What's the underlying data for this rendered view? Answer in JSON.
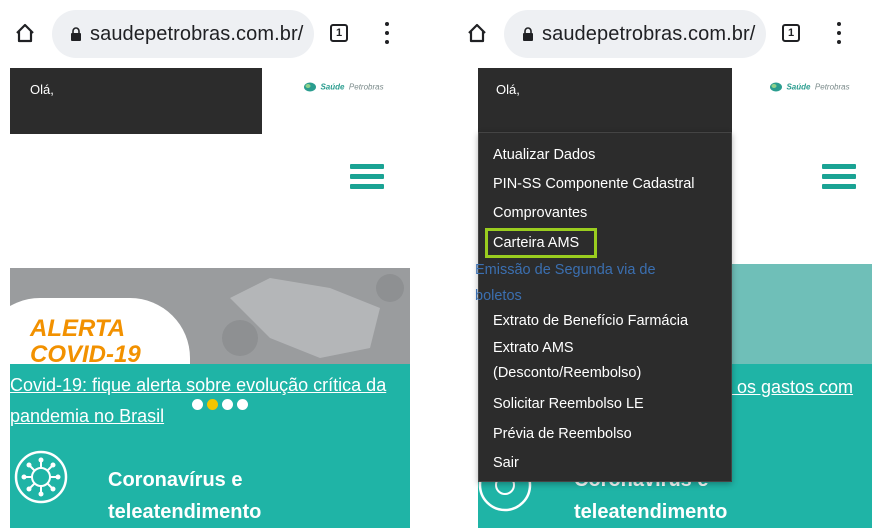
{
  "browser": {
    "url": "saudepetrobras.com.br/",
    "tab_count": "1"
  },
  "site": {
    "greeting": "Olá,",
    "logo_primary": "Saúde",
    "logo_secondary": "Petrobras"
  },
  "banner": {
    "alert_line1": "ALERTA",
    "alert_line2": "COVID-19",
    "link_text_left": "Covid-19: fique alerta sobre evolução crítica da pandemia no Brasil",
    "link_text_right": "r os gastos com",
    "carousel_dots": 4,
    "carousel_active": 2
  },
  "section": {
    "title": "Coronavírus e teleatendimento"
  },
  "menu": {
    "items": [
      "Atualizar Dados",
      "PIN-SS Componente Cadastral",
      "Comprovantes",
      "Carteira AMS",
      "Emissão de Segunda via de boletos",
      "Extrato de Benefício Farmácia",
      "Extrato AMS (Desconto/Reembolso)",
      "Solicitar Reembolso LE",
      "Prévia de Reembolso",
      "Sair"
    ],
    "highlighted_index": 3
  },
  "colors": {
    "teal": "#1fb4a6",
    "alert_orange": "#f29100",
    "highlight_green": "#9acd1f",
    "menu_bg": "#2c2c2c"
  }
}
